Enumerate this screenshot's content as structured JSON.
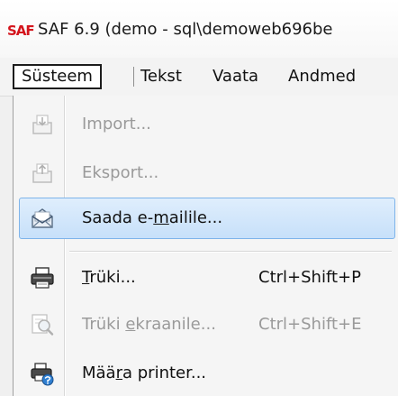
{
  "window": {
    "logo_text": "SAF",
    "title": "SAF 6.9 (demo - sql\\demoweb696be"
  },
  "menubar": {
    "items": [
      {
        "label": "Süsteem",
        "active": true
      },
      {
        "label": "Tekst"
      },
      {
        "label": "Vaata"
      },
      {
        "label": "Andmed"
      }
    ]
  },
  "dropdown": {
    "items": [
      {
        "icon": "import-icon",
        "pre": "Import...",
        "mn": "",
        "post": "",
        "shortcut": "",
        "disabled": true
      },
      {
        "icon": "export-icon",
        "pre": "Eksport...",
        "mn": "",
        "post": "",
        "shortcut": "",
        "disabled": true
      },
      {
        "icon": "email-icon",
        "pre": "Saada e-",
        "mn": "m",
        "post": "ailile...",
        "shortcut": "",
        "disabled": false,
        "highlighted": true
      },
      {
        "icon": "printer-icon",
        "pre": "",
        "mn": "T",
        "post": "rüki...",
        "shortcut": "Ctrl+Shift+P",
        "disabled": false
      },
      {
        "icon": "print-preview-icon",
        "pre": "Trüki ",
        "mn": "e",
        "post": "kraanile...",
        "shortcut": "Ctrl+Shift+E",
        "disabled": true
      },
      {
        "icon": "printer-setup-icon",
        "pre": "Mää",
        "mn": "r",
        "post": "a printer...",
        "shortcut": "",
        "disabled": false
      }
    ]
  },
  "colors": {
    "logo_red": "#d4141c",
    "highlight_border": "#7eb4ea",
    "disabled_text": "#9a9a9a"
  }
}
